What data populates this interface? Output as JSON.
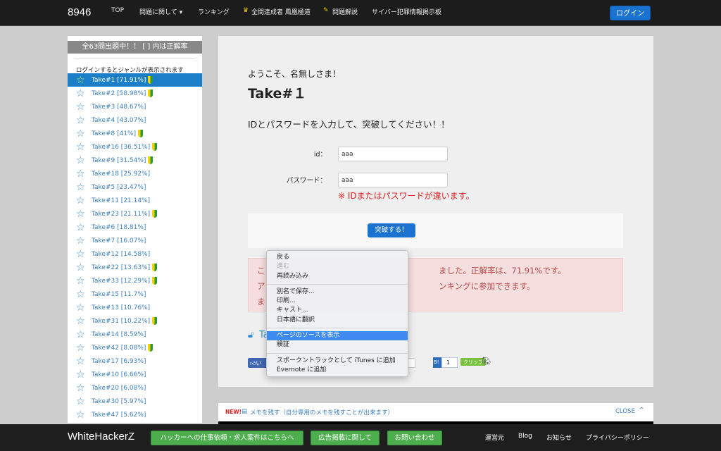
{
  "header": {
    "brand": "8946",
    "nav": [
      "TOP",
      "問題に関して ▾",
      "ランキング",
      "全問達成者 鳳凰極道",
      "問題解説",
      "サイバー犯罪情報掲示板"
    ],
    "login": "ログイン"
  },
  "sidebar": {
    "title": "全63問出題中！！ [ ] 内は正解率",
    "note": "ログインするとジャンルが表示されます",
    "items": [
      {
        "label": "Take#1 [71.91%]",
        "beginner": true,
        "active": true
      },
      {
        "label": "Take#2 [58.98%]",
        "beginner": true
      },
      {
        "label": "Take#3 [48.67%]",
        "beginner": false
      },
      {
        "label": "Take#4 [43.07%]",
        "beginner": false
      },
      {
        "label": "Take#8 [41%]",
        "beginner": true
      },
      {
        "label": "Take#16 [36.51%]",
        "beginner": true
      },
      {
        "label": "Take#9 [31.54%]",
        "beginner": true
      },
      {
        "label": "Take#18 [25.92%]",
        "beginner": false
      },
      {
        "label": "Take#5 [23.47%]",
        "beginner": false
      },
      {
        "label": "Take#11 [21.14%]",
        "beginner": false
      },
      {
        "label": "Take#23 [21.11%]",
        "beginner": true
      },
      {
        "label": "Take#6 [18.81%]",
        "beginner": false
      },
      {
        "label": "Take#7 [16.07%]",
        "beginner": false
      },
      {
        "label": "Take#12 [14.58%]",
        "beginner": false
      },
      {
        "label": "Take#22 [13.63%]",
        "beginner": true
      },
      {
        "label": "Take#33 [12.29%]",
        "beginner": true
      },
      {
        "label": "Take#15 [11.7%]",
        "beginner": false
      },
      {
        "label": "Take#13 [10.76%]",
        "beginner": false
      },
      {
        "label": "Take#31 [10.22%]",
        "beginner": true
      },
      {
        "label": "Take#14 [8.59%]",
        "beginner": false
      },
      {
        "label": "Take#42 [8.08%]",
        "beginner": true
      },
      {
        "label": "Take#17 [6.93%]",
        "beginner": false
      },
      {
        "label": "Take#10 [6.66%]",
        "beginner": false
      },
      {
        "label": "Take#20 [6.08%]",
        "beginner": false
      },
      {
        "label": "Take#30 [5.97%]",
        "beginner": false
      },
      {
        "label": "Take#47 [5.62%]",
        "beginner": false
      }
    ]
  },
  "main": {
    "greeting": "ようこそ、名無しさま！",
    "title": "Take#１",
    "instruction": "IDとパスワードを入力して、突破してください！！",
    "id_label": "id：",
    "id_value": "aaa",
    "pw_label": "パスワード：",
    "pw_value": "aaa",
    "error": "※ IDまたはパスワードが違います。",
    "submit": "突破する！",
    "alert": {
      "l1a": "こ",
      "l1b": "ました。正解率は、71.91%です。",
      "l2a": "ア",
      "l2b": "ンキングに参加できます。",
      "l3a": "ま"
    },
    "link_fragment": "Ta",
    "like_fragment": "い",
    "hatena_count": "1",
    "clip": "クリップ"
  },
  "context_menu": {
    "items": [
      "戻る",
      "進む",
      "再読み込み",
      "別名で保存...",
      "印刷...",
      "キャスト...",
      "日本語に翻訳",
      "ページのソースを表示",
      "検証",
      "スポークントラックとして iTunes に追加",
      "Evernote に追加"
    ],
    "highlighted": "ページのソースを表示",
    "disabled": [
      "進む"
    ]
  },
  "memo": {
    "badge": "NEW!",
    "text": "メモを残す（自分専用のメモを残すことが出来ます）",
    "close": "CLOSE"
  },
  "footer": {
    "brand": "WhiteHackerZ",
    "buttons": [
      "ハッカーへの仕事依頼・求人案件はこちらへ",
      "広告掲載に関して",
      "お問い合わせ"
    ],
    "links": [
      "運営元",
      "Blog",
      "お知らせ",
      "プライバシーポリシー"
    ]
  },
  "colors": {
    "accent": "#1a73d0",
    "error": "#e02020",
    "green": "#4cae4c"
  }
}
